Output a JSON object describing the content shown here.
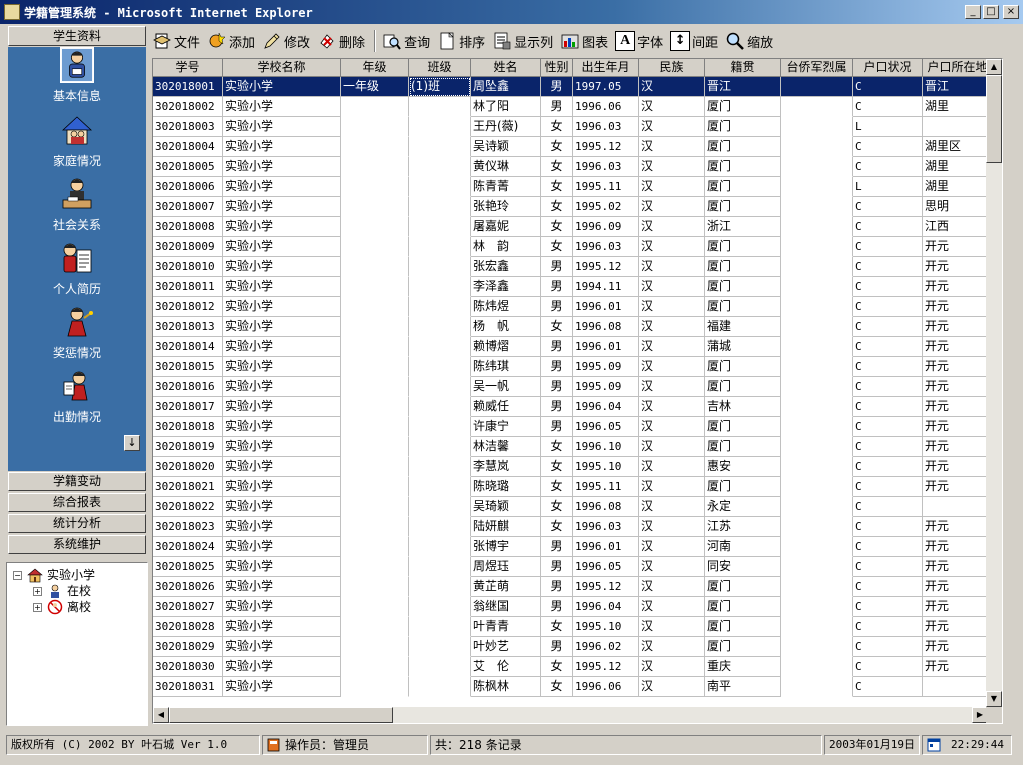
{
  "window": {
    "title": "学籍管理系统 - Microsoft Internet Explorer",
    "minimize": "_",
    "maximize": "□",
    "close": "×"
  },
  "left_panel": {
    "header": "学生资料",
    "icons": [
      {
        "label": "基本信息",
        "icon": "person-reading-icon",
        "selected": true
      },
      {
        "label": "家庭情况",
        "icon": "family-house-icon",
        "selected": false
      },
      {
        "label": "社会关系",
        "icon": "person-at-desk-icon",
        "selected": false
      },
      {
        "label": "个人简历",
        "icon": "resume-document-icon",
        "selected": false
      },
      {
        "label": "奖惩情况",
        "icon": "award-person-icon",
        "selected": false
      },
      {
        "label": "出勤情况",
        "icon": "attendance-person-icon",
        "selected": false
      }
    ],
    "scroll_down": "↓",
    "nav_buttons": [
      "学籍变动",
      "综合报表",
      "统计分析",
      "系统维护"
    ],
    "tree": {
      "root": {
        "label": "实验小学",
        "expander": "−"
      },
      "children": [
        {
          "label": "在校",
          "expander": "+"
        },
        {
          "label": "离校",
          "expander": "+"
        }
      ]
    }
  },
  "toolbar": {
    "buttons": [
      {
        "label": "文件",
        "icon": "file-icon"
      },
      {
        "label": "添加",
        "icon": "add-icon"
      },
      {
        "label": "修改",
        "icon": "edit-pencil-icon"
      },
      {
        "label": "删除",
        "icon": "delete-icon"
      },
      {
        "label": "查询",
        "icon": "search-icon"
      },
      {
        "label": "排序",
        "icon": "sort-icon"
      },
      {
        "label": "显示列",
        "icon": "columns-icon"
      },
      {
        "label": "图表",
        "icon": "chart-icon"
      },
      {
        "label": "字体",
        "icon": "font-icon",
        "glyph": "A"
      },
      {
        "label": "间距",
        "icon": "spacing-icon",
        "glyph": "↕"
      },
      {
        "label": "缩放",
        "icon": "zoom-icon"
      }
    ]
  },
  "grid": {
    "columns": [
      "学号",
      "学校名称",
      "年级",
      "班级",
      "姓名",
      "性别",
      "出生年月",
      "民族",
      "籍贯",
      "台侨军烈属",
      "户口状况",
      "户口所在地"
    ],
    "rows": [
      [
        "302018001",
        "实验小学",
        "一年级",
        "(1)班",
        "周坠鑫",
        "男",
        "1997.05",
        "汉",
        "晋江",
        "",
        "C",
        "晋江"
      ],
      [
        "302018002",
        "实验小学",
        "",
        "",
        "林了阳",
        "男",
        "1996.06",
        "汉",
        "厦门",
        "",
        "C",
        "湖里"
      ],
      [
        "302018003",
        "实验小学",
        "",
        "",
        "王丹(薇)",
        "女",
        "1996.03",
        "汉",
        "厦门",
        "",
        "L",
        ""
      ],
      [
        "302018004",
        "实验小学",
        "",
        "",
        "吴诗颖",
        "女",
        "1995.12",
        "汉",
        "厦门",
        "",
        "C",
        "湖里区"
      ],
      [
        "302018005",
        "实验小学",
        "",
        "",
        "黄仪琳",
        "女",
        "1996.03",
        "汉",
        "厦门",
        "",
        "C",
        "湖里"
      ],
      [
        "302018006",
        "实验小学",
        "",
        "",
        "陈青菁",
        "女",
        "1995.11",
        "汉",
        "厦门",
        "",
        "L",
        "湖里"
      ],
      [
        "302018007",
        "实验小学",
        "",
        "",
        "张艳玲",
        "女",
        "1995.02",
        "汉",
        "厦门",
        "",
        "C",
        "思明"
      ],
      [
        "302018008",
        "实验小学",
        "",
        "",
        "屠嘉妮",
        "女",
        "1996.09",
        "汉",
        "浙江",
        "",
        "C",
        "江西"
      ],
      [
        "302018009",
        "实验小学",
        "",
        "",
        "林　韵",
        "女",
        "1996.03",
        "汉",
        "厦门",
        "",
        "C",
        "开元"
      ],
      [
        "302018010",
        "实验小学",
        "",
        "",
        "张宏鑫",
        "男",
        "1995.12",
        "汉",
        "厦门",
        "",
        "C",
        "开元"
      ],
      [
        "302018011",
        "实验小学",
        "",
        "",
        "李泽鑫",
        "男",
        "1994.11",
        "汉",
        "厦门",
        "",
        "C",
        "开元"
      ],
      [
        "302018012",
        "实验小学",
        "",
        "",
        "陈炜煜",
        "男",
        "1996.01",
        "汉",
        "厦门",
        "",
        "C",
        "开元"
      ],
      [
        "302018013",
        "实验小学",
        "",
        "",
        "杨　帆",
        "女",
        "1996.08",
        "汉",
        "福建",
        "",
        "C",
        "开元"
      ],
      [
        "302018014",
        "实验小学",
        "",
        "",
        "赖博熠",
        "男",
        "1996.01",
        "汉",
        "蒲城",
        "",
        "C",
        "开元"
      ],
      [
        "302018015",
        "实验小学",
        "",
        "",
        "陈纬琪",
        "男",
        "1995.09",
        "汉",
        "厦门",
        "",
        "C",
        "开元"
      ],
      [
        "302018016",
        "实验小学",
        "",
        "",
        "吴一帆",
        "男",
        "1995.09",
        "汉",
        "厦门",
        "",
        "C",
        "开元"
      ],
      [
        "302018017",
        "实验小学",
        "",
        "",
        "赖威任",
        "男",
        "1996.04",
        "汉",
        "吉林",
        "",
        "C",
        "开元"
      ],
      [
        "302018018",
        "实验小学",
        "",
        "",
        "许康宁",
        "男",
        "1996.05",
        "汉",
        "厦门",
        "",
        "C",
        "开元"
      ],
      [
        "302018019",
        "实验小学",
        "",
        "",
        "林洁馨",
        "女",
        "1996.10",
        "汉",
        "厦门",
        "",
        "C",
        "开元"
      ],
      [
        "302018020",
        "实验小学",
        "",
        "",
        "李慧岚",
        "女",
        "1995.10",
        "汉",
        "惠安",
        "",
        "C",
        "开元"
      ],
      [
        "302018021",
        "实验小学",
        "",
        "",
        "陈晓璐",
        "女",
        "1995.11",
        "汉",
        "厦门",
        "",
        "C",
        "开元"
      ],
      [
        "302018022",
        "实验小学",
        "",
        "",
        "吴琦颖",
        "女",
        "1996.08",
        "汉",
        "永定",
        "",
        "C",
        ""
      ],
      [
        "302018023",
        "实验小学",
        "",
        "",
        "陆妍麒",
        "女",
        "1996.03",
        "汉",
        "江苏",
        "",
        "C",
        "开元"
      ],
      [
        "302018024",
        "实验小学",
        "",
        "",
        "张博宇",
        "男",
        "1996.01",
        "汉",
        "河南",
        "",
        "C",
        "开元"
      ],
      [
        "302018025",
        "实验小学",
        "",
        "",
        "周煜珏",
        "男",
        "1996.05",
        "汉",
        "同安",
        "",
        "C",
        "开元"
      ],
      [
        "302018026",
        "实验小学",
        "",
        "",
        "黄芷萌",
        "男",
        "1995.12",
        "汉",
        "厦门",
        "",
        "C",
        "开元"
      ],
      [
        "302018027",
        "实验小学",
        "",
        "",
        "翁继国",
        "男",
        "1996.04",
        "汉",
        "厦门",
        "",
        "C",
        "开元"
      ],
      [
        "302018028",
        "实验小学",
        "",
        "",
        "叶青青",
        "女",
        "1995.10",
        "汉",
        "厦门",
        "",
        "C",
        "开元"
      ],
      [
        "302018029",
        "实验小学",
        "",
        "",
        "叶妙艺",
        "男",
        "1996.02",
        "汉",
        "厦门",
        "",
        "C",
        "开元"
      ],
      [
        "302018030",
        "实验小学",
        "",
        "",
        "艾　伦",
        "女",
        "1995.12",
        "汉",
        "重庆",
        "",
        "C",
        "开元"
      ],
      [
        "302018031",
        "实验小学",
        "",
        "",
        "陈枫林",
        "女",
        "1996.06",
        "汉",
        "南平",
        "",
        "C",
        ""
      ]
    ],
    "selected_row": 0,
    "vscroll_up": "▲",
    "vscroll_down": "▼",
    "hscroll_left": "◀",
    "hscroll_right": "▶"
  },
  "statusbar": {
    "copyright": "版权所有 (C) 2002 BY 叶石城 Ver 1.0",
    "operator": "操作员：管理员",
    "records": "共：218 条记录",
    "date": "2003年01月19日",
    "time": "22:29:44"
  },
  "colors": {
    "titlebar": "#0a246a",
    "nav_panel": "#3a6ea5",
    "selection": "#0a246a",
    "window_bg": "#d4d0c8"
  }
}
